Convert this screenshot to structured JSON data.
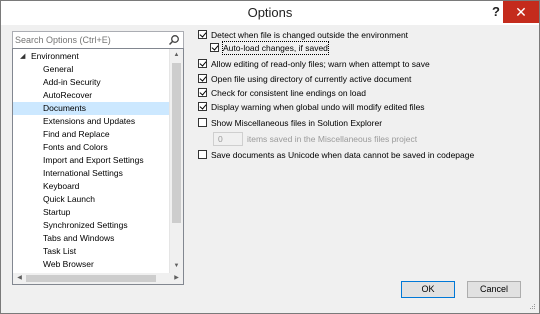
{
  "window": {
    "title": "Options",
    "help_label": "?",
    "close_label": "✕"
  },
  "search": {
    "placeholder": "Search Options (Ctrl+E)",
    "icon": "search-icon"
  },
  "tree": {
    "root_label": "Environment",
    "root_expander": "◢",
    "items": [
      {
        "label": "General"
      },
      {
        "label": "Add-in Security"
      },
      {
        "label": "AutoRecover"
      },
      {
        "label": "Documents",
        "selected": true
      },
      {
        "label": "Extensions and Updates"
      },
      {
        "label": "Find and Replace"
      },
      {
        "label": "Fonts and Colors"
      },
      {
        "label": "Import and Export Settings"
      },
      {
        "label": "International Settings"
      },
      {
        "label": "Keyboard"
      },
      {
        "label": "Quick Launch"
      },
      {
        "label": "Startup"
      },
      {
        "label": "Synchronized Settings"
      },
      {
        "label": "Tabs and Windows"
      },
      {
        "label": "Task List"
      },
      {
        "label": "Web Browser"
      }
    ]
  },
  "options": [
    {
      "label": "Detect when file is changed outside the environment",
      "checked": true
    },
    {
      "label": "Auto-load changes, if saved",
      "checked": true,
      "indent": true,
      "focused": true
    },
    {
      "label": "Allow editing of read-only files; warn when attempt to save",
      "checked": true
    },
    {
      "label": "Open file using directory of currently active document",
      "checked": true
    },
    {
      "label": "Check for consistent line endings on load",
      "checked": true
    },
    {
      "label": "Display warning when global undo will modify edited files",
      "checked": true
    },
    {
      "label": "Show Miscellaneous files in Solution Explorer",
      "checked": false
    },
    {
      "label": "Save documents as Unicode when data cannot be saved in codepage",
      "checked": false
    }
  ],
  "misc_items": {
    "value": "0",
    "suffix": "items saved in the Miscellaneous files project"
  },
  "buttons": {
    "ok": "OK",
    "cancel": "Cancel"
  },
  "colors": {
    "selection": "#cce8ff",
    "close_button": "#c42b1c",
    "default_button_border": "#0078d7"
  }
}
